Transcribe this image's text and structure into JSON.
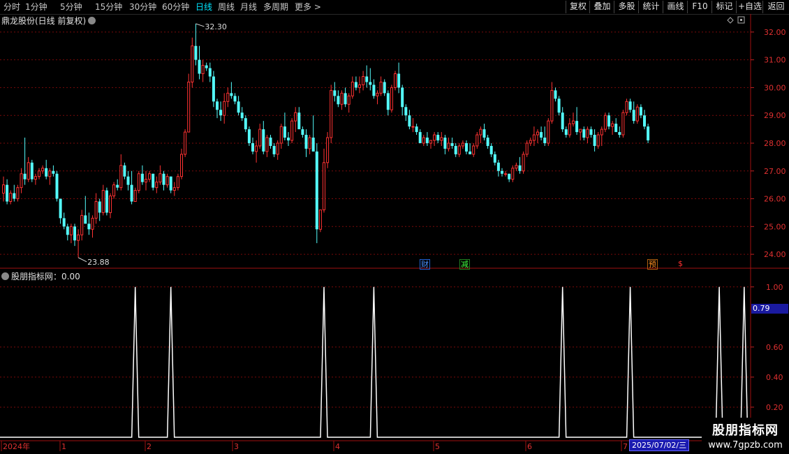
{
  "toolbar": {
    "periods": [
      "分时",
      "1分钟",
      "5分钟",
      "15分钟",
      "30分钟",
      "60分钟",
      "日线",
      "周线",
      "月线",
      "多周期",
      "更多 >"
    ],
    "active_period": "日线",
    "right_buttons": [
      "复权",
      "叠加",
      "多股",
      "统计",
      "画线",
      "F10",
      "标记",
      "+自选",
      "返回"
    ]
  },
  "main_chart": {
    "title": "鼎龙股份(日线 前复权)",
    "y_ticks": [
      "32.00",
      "31.00",
      "30.00",
      "29.00",
      "28.00",
      "27.00",
      "26.00",
      "25.00",
      "24.00"
    ],
    "y_values": [
      32,
      31,
      30,
      29,
      28,
      27,
      26,
      25,
      24
    ],
    "y_range": [
      23.6,
      32.6
    ],
    "high_marker": "32.30",
    "low_marker": "23.88",
    "up_color": "#ff3232",
    "down_color": "#54fcfc",
    "events": [
      {
        "label": "财",
        "color": "#4a90ff",
        "border": "#2060d0"
      },
      {
        "label": "减",
        "color": "#40ff40",
        "border": "#208020"
      },
      {
        "label": "预",
        "color": "#ff9020",
        "border": "#b06010"
      },
      {
        "label": "$",
        "color": "#ff3030",
        "border": "#000"
      }
    ]
  },
  "sub_chart": {
    "title": "股朋指标网：0.00",
    "y_ticks": [
      "1.00",
      "0.60",
      "0.40",
      "0.20"
    ],
    "y_values": [
      1.0,
      0.6,
      0.4,
      0.2
    ],
    "current_value": "0.79"
  },
  "x_axis": {
    "labels": [
      "2024年",
      "1",
      "2",
      "3",
      "4",
      "5",
      "6",
      "7"
    ],
    "date_box": "2025/07/02/三"
  },
  "watermark": {
    "title": "股朋指标网",
    "url": "www.7gpzb.com"
  },
  "chart_data": [
    {
      "type": "candlestick",
      "title": "鼎龙股份(日线 前复权)",
      "ylim": [
        23.6,
        32.6
      ],
      "candles_ohlc": [
        [
          26.2,
          26.8,
          25.9,
          26.5
        ],
        [
          26.5,
          26.7,
          25.8,
          25.9
        ],
        [
          25.9,
          26.3,
          25.8,
          26.2
        ],
        [
          26.2,
          26.5,
          25.9,
          26.0
        ],
        [
          26.0,
          26.5,
          25.9,
          26.4
        ],
        [
          26.4,
          27.1,
          26.2,
          26.9
        ],
        [
          26.9,
          28.2,
          26.5,
          26.7
        ],
        [
          26.7,
          27.5,
          26.6,
          27.3
        ],
        [
          27.3,
          27.4,
          26.6,
          26.7
        ],
        [
          26.7,
          26.9,
          26.5,
          26.8
        ],
        [
          26.8,
          27.1,
          26.7,
          27.0
        ],
        [
          27.0,
          27.2,
          26.9,
          27.1
        ],
        [
          27.1,
          27.4,
          26.7,
          26.8
        ],
        [
          26.8,
          27.1,
          26.5,
          27.0
        ],
        [
          27.0,
          27.2,
          26.8,
          26.9
        ],
        [
          26.9,
          27.0,
          25.9,
          26.0
        ],
        [
          26.0,
          26.0,
          25.1,
          25.3
        ],
        [
          25.3,
          25.5,
          24.9,
          25.0
        ],
        [
          25.0,
          25.1,
          24.5,
          24.7
        ],
        [
          24.7,
          25.1,
          24.4,
          25.0
        ],
        [
          25.0,
          25.1,
          24.3,
          24.5
        ],
        [
          24.5,
          24.9,
          23.88,
          24.7
        ],
        [
          24.7,
          25.6,
          24.5,
          25.4
        ],
        [
          25.4,
          26.1,
          25.2,
          25.1
        ],
        [
          25.1,
          25.5,
          24.7,
          24.9
        ],
        [
          24.9,
          25.4,
          24.6,
          25.3
        ],
        [
          25.3,
          26.2,
          25.1,
          25.9
        ],
        [
          25.9,
          26.0,
          25.2,
          25.5
        ],
        [
          25.5,
          26.5,
          25.4,
          26.3
        ],
        [
          26.3,
          26.4,
          25.4,
          25.5
        ],
        [
          25.5,
          26.2,
          25.3,
          26.1
        ],
        [
          26.1,
          26.6,
          26.0,
          26.5
        ],
        [
          26.5,
          26.7,
          26.3,
          26.4
        ],
        [
          26.4,
          27.6,
          26.3,
          27.2
        ],
        [
          27.2,
          27.3,
          26.7,
          26.8
        ],
        [
          26.8,
          27.0,
          26.3,
          26.5
        ],
        [
          26.5,
          27.0,
          25.8,
          25.9
        ],
        [
          25.9,
          26.4,
          25.9,
          26.3
        ],
        [
          26.3,
          27.0,
          26.2,
          26.9
        ],
        [
          26.9,
          27.2,
          26.5,
          26.6
        ],
        [
          26.6,
          27.0,
          26.3,
          26.7
        ],
        [
          26.7,
          27.0,
          26.6,
          26.9
        ],
        [
          26.9,
          26.9,
          26.3,
          26.4
        ],
        [
          26.4,
          26.8,
          26.2,
          26.6
        ],
        [
          26.6,
          27.2,
          26.5,
          26.9
        ],
        [
          26.9,
          27.0,
          26.3,
          26.5
        ],
        [
          26.5,
          26.9,
          26.4,
          26.8
        ],
        [
          26.8,
          26.8,
          26.2,
          26.3
        ],
        [
          26.3,
          26.6,
          26.1,
          26.4
        ],
        [
          26.4,
          26.9,
          26.3,
          26.8
        ],
        [
          26.8,
          27.8,
          26.7,
          27.6
        ],
        [
          27.6,
          28.5,
          27.5,
          28.4
        ],
        [
          28.4,
          30.5,
          29.0,
          30.2
        ],
        [
          30.2,
          31.8,
          30.0,
          31.5
        ],
        [
          31.5,
          32.3,
          30.8,
          31.0
        ],
        [
          31.0,
          31.5,
          30.3,
          30.5
        ],
        [
          30.5,
          31.0,
          30.2,
          30.8
        ],
        [
          30.8,
          30.9,
          30.6,
          30.7
        ],
        [
          30.7,
          30.9,
          30.2,
          30.4
        ],
        [
          30.4,
          30.6,
          29.3,
          29.5
        ],
        [
          29.5,
          29.6,
          28.9,
          29.2
        ],
        [
          29.2,
          29.5,
          28.8,
          29.0
        ],
        [
          29.0,
          29.8,
          28.7,
          29.5
        ],
        [
          29.5,
          30.0,
          29.3,
          29.8
        ],
        [
          29.8,
          30.2,
          29.6,
          29.7
        ],
        [
          29.7,
          29.8,
          29.4,
          29.5
        ],
        [
          29.5,
          29.7,
          29.0,
          29.1
        ],
        [
          29.1,
          29.3,
          28.8,
          28.9
        ],
        [
          28.9,
          29.0,
          28.4,
          28.5
        ],
        [
          28.5,
          28.6,
          27.9,
          28.0
        ],
        [
          28.0,
          28.2,
          27.6,
          27.7
        ],
        [
          27.7,
          28.1,
          27.3,
          27.9
        ],
        [
          27.9,
          28.7,
          27.8,
          28.5
        ],
        [
          28.5,
          28.8,
          27.6,
          27.7
        ],
        [
          27.7,
          28.3,
          27.5,
          28.2
        ],
        [
          28.2,
          28.3,
          27.8,
          27.9
        ],
        [
          27.9,
          28.0,
          27.5,
          27.6
        ],
        [
          27.6,
          28.1,
          27.4,
          28.0
        ],
        [
          28.0,
          28.7,
          27.8,
          28.6
        ],
        [
          28.6,
          29.1,
          28.1,
          28.2
        ],
        [
          28.2,
          28.4,
          27.9,
          28.1
        ],
        [
          28.1,
          28.9,
          28.0,
          28.8
        ],
        [
          28.8,
          29.3,
          28.4,
          29.1
        ],
        [
          29.1,
          29.3,
          28.7,
          28.5
        ],
        [
          28.5,
          28.6,
          28.2,
          28.3
        ],
        [
          28.3,
          28.5,
          27.5,
          27.8
        ],
        [
          27.8,
          28.3,
          27.6,
          28.2
        ],
        [
          28.2,
          29.0,
          27.9,
          27.7
        ],
        [
          27.7,
          28.0,
          24.4,
          24.9
        ],
        [
          24.9,
          25.5,
          24.8,
          25.6
        ],
        [
          25.6,
          27.8,
          25.5,
          27.3
        ],
        [
          27.3,
          28.4,
          27.1,
          28.2
        ],
        [
          28.2,
          30.1,
          28.0,
          29.9
        ],
        [
          29.9,
          30.2,
          29.5,
          29.7
        ],
        [
          29.7,
          29.9,
          29.3,
          29.4
        ],
        [
          29.4,
          29.9,
          29.2,
          29.8
        ],
        [
          29.8,
          30.0,
          29.3,
          29.4
        ],
        [
          29.4,
          29.8,
          29.1,
          29.7
        ],
        [
          29.7,
          30.4,
          29.6,
          30.2
        ],
        [
          30.2,
          30.4,
          29.9,
          30.0
        ],
        [
          30.0,
          30.4,
          29.8,
          30.1
        ],
        [
          30.1,
          30.6,
          29.9,
          30.4
        ],
        [
          30.4,
          30.8,
          30.0,
          30.2
        ],
        [
          30.2,
          30.7,
          29.9,
          30.1
        ],
        [
          30.1,
          30.3,
          29.6,
          29.7
        ],
        [
          29.7,
          29.9,
          29.4,
          29.8
        ],
        [
          29.8,
          30.4,
          29.7,
          30.2
        ],
        [
          30.2,
          30.3,
          29.7,
          29.8
        ],
        [
          29.8,
          29.9,
          29.0,
          29.2
        ],
        [
          29.2,
          30.1,
          29.1,
          30.0
        ],
        [
          30.0,
          30.6,
          29.9,
          30.5
        ],
        [
          30.5,
          30.9,
          29.8,
          30.0
        ],
        [
          30.0,
          30.1,
          29.0,
          29.3
        ],
        [
          29.3,
          29.4,
          28.8,
          29.0
        ],
        [
          29.0,
          29.2,
          28.5,
          28.6
        ],
        [
          28.6,
          28.9,
          28.4,
          28.6
        ],
        [
          28.6,
          28.7,
          28.3,
          28.4
        ],
        [
          28.4,
          28.5,
          28.1,
          28.0
        ],
        [
          28.0,
          28.3,
          27.9,
          28.2
        ],
        [
          28.2,
          28.4,
          27.9,
          28.0
        ],
        [
          28.0,
          28.1,
          27.8,
          28.1
        ],
        [
          28.1,
          28.4,
          27.9,
          28.3
        ],
        [
          28.3,
          28.4,
          28.0,
          28.1
        ],
        [
          28.1,
          28.4,
          27.9,
          28.2
        ],
        [
          28.2,
          28.3,
          27.6,
          27.8
        ],
        [
          27.8,
          28.2,
          27.7,
          28.0
        ],
        [
          28.0,
          28.2,
          27.8,
          27.9
        ],
        [
          27.9,
          28.0,
          27.5,
          27.6
        ],
        [
          27.6,
          28.0,
          27.5,
          27.9
        ],
        [
          27.9,
          28.1,
          27.8,
          28.0
        ],
        [
          28.0,
          28.1,
          27.6,
          27.7
        ],
        [
          27.7,
          28.0,
          27.6,
          27.6
        ],
        [
          27.6,
          28.0,
          27.5,
          27.9
        ],
        [
          27.9,
          28.4,
          27.8,
          28.3
        ],
        [
          28.3,
          28.6,
          28.0,
          28.5
        ],
        [
          28.5,
          28.7,
          28.1,
          28.2
        ],
        [
          28.2,
          28.3,
          27.8,
          27.9
        ],
        [
          27.9,
          28.0,
          27.5,
          27.6
        ],
        [
          27.6,
          27.7,
          27.2,
          27.3
        ],
        [
          27.3,
          27.4,
          26.8,
          27.0
        ],
        [
          27.0,
          27.1,
          26.8,
          26.9
        ],
        [
          26.9,
          27.0,
          26.8,
          26.9
        ],
        [
          26.9,
          26.9,
          26.6,
          26.7
        ],
        [
          26.7,
          27.2,
          26.6,
          27.1
        ],
        [
          27.1,
          27.3,
          27.0,
          27.2
        ],
        [
          27.2,
          27.5,
          26.9,
          27.0
        ],
        [
          27.0,
          27.7,
          26.9,
          27.6
        ],
        [
          27.6,
          28.1,
          27.5,
          28.0
        ],
        [
          28.0,
          28.2,
          27.9,
          28.1
        ],
        [
          28.1,
          28.6,
          27.9,
          28.3
        ],
        [
          28.3,
          28.5,
          28.0,
          28.4
        ],
        [
          28.4,
          28.6,
          28.1,
          28.2
        ],
        [
          28.2,
          28.6,
          27.9,
          28.0
        ],
        [
          28.0,
          28.9,
          27.9,
          28.8
        ],
        [
          28.8,
          30.2,
          28.7,
          29.9
        ],
        [
          29.9,
          30.0,
          29.5,
          29.6
        ],
        [
          29.6,
          29.7,
          29.0,
          29.1
        ],
        [
          29.1,
          29.3,
          28.4,
          28.5
        ],
        [
          28.5,
          28.6,
          28.2,
          28.3
        ],
        [
          28.3,
          28.9,
          28.2,
          28.7
        ],
        [
          28.7,
          29.1,
          28.6,
          28.8
        ],
        [
          28.8,
          29.3,
          28.3,
          28.4
        ],
        [
          28.4,
          28.5,
          28.1,
          28.5
        ],
        [
          28.5,
          28.6,
          28.1,
          28.2
        ],
        [
          28.2,
          28.6,
          28.0,
          28.5
        ],
        [
          28.5,
          28.6,
          28.2,
          28.3
        ],
        [
          28.3,
          28.5,
          27.7,
          27.9
        ],
        [
          27.9,
          28.4,
          27.8,
          28.3
        ],
        [
          28.3,
          28.6,
          27.9,
          28.5
        ],
        [
          28.5,
          29.1,
          28.4,
          29.0
        ],
        [
          29.0,
          29.1,
          28.5,
          28.6
        ],
        [
          28.6,
          28.8,
          28.3,
          28.7
        ],
        [
          28.7,
          28.9,
          28.4,
          28.4
        ],
        [
          28.4,
          28.6,
          28.2,
          28.3
        ],
        [
          28.3,
          29.2,
          28.2,
          29.1
        ],
        [
          29.1,
          29.6,
          29.0,
          29.5
        ],
        [
          29.5,
          29.6,
          29.1,
          29.2
        ],
        [
          29.2,
          29.5,
          28.7,
          28.8
        ],
        [
          28.8,
          29.4,
          28.7,
          29.3
        ],
        [
          29.3,
          29.4,
          28.9,
          29.0
        ],
        [
          29.0,
          29.2,
          28.5,
          28.6
        ],
        [
          28.6,
          28.7,
          28.0,
          28.1
        ]
      ]
    },
    {
      "type": "line",
      "title": "股朋指标网",
      "ylim": [
        0,
        1.05
      ],
      "x_candle_index": [
        37,
        47,
        90,
        104,
        157,
        176,
        201,
        208
      ],
      "values": [
        1,
        1,
        1,
        1,
        1,
        1,
        1,
        1
      ],
      "baseline": 0
    }
  ]
}
